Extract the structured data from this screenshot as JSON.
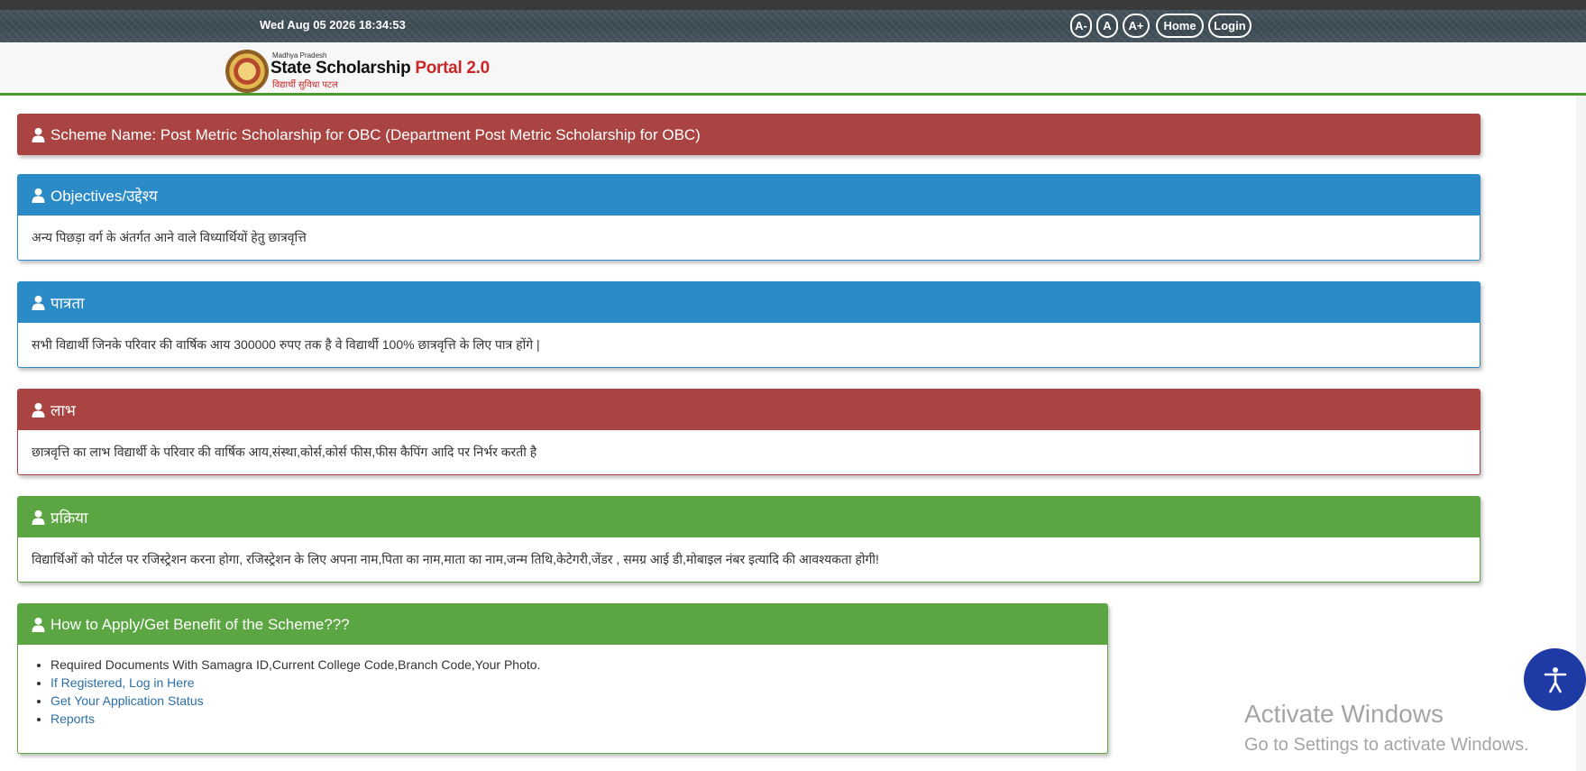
{
  "topbar": {
    "datetime": "Wed Aug 05 2026 18:34:53",
    "font_decrease": "A-",
    "font_normal": "A",
    "font_increase": "A+",
    "home": "Home",
    "login": "Login"
  },
  "header": {
    "logo_state": "Madhya Pradesh",
    "logo_title": "State Scholarship",
    "logo_title_accent": "Portal 2.0",
    "logo_tagline": "विद्यार्थी सुविधा पटल"
  },
  "scheme": {
    "title": "Scheme Name: Post Metric Scholarship for OBC (Department Post Metric Scholarship for OBC)"
  },
  "sections": [
    {
      "title": "Objectives/उद्देश्य",
      "text": "अन्य पिछड़ा वर्ग के अंतर्गत आने वाले विध्यार्थियों हेतु छात्रवृत्ति"
    },
    {
      "title": "पात्रता",
      "text": "सभी विद्यार्थी जिनके परिवार की वार्षिक आय 300000 रुपए तक है वे विद्यार्थी 100% छात्रवृत्ति के लिए पात्र होंगे |"
    },
    {
      "title": "लाभ",
      "text": "छात्रवृत्ति का लाभ विद्यार्थी के परिवार की वार्षिक आय,संस्था,कोर्स,कोर्स फीस,फीस कैपिंग आदि पर निर्भर करती है"
    },
    {
      "title": "प्रक्रिया",
      "text": "विद्यार्थिओं को पोर्टल पर रजिस्ट्रेशन करना होगा, रजिस्ट्रेशन के लिए अपना नाम,पिता का नाम,माता का नाम,जन्म तिथि,केटेगरी,जेंडर , समग्र आई डी,मोबाइल नंबर इत्यादि की आवश्यकता होगी!"
    }
  ],
  "apply": {
    "title": "How to Apply/Get Benefit of the Scheme???",
    "documents": "Required Documents With Samagra ID,Current College Code,Branch Code,Your Photo.",
    "link_login": "If Registered, Log in Here",
    "link_status": "Get Your Application Status",
    "link_reports": "Reports"
  },
  "watermark": {
    "line1": "Activate Windows",
    "line2": "Go to Settings to activate Windows."
  },
  "colors": {
    "red": "#a94442",
    "blue": "#2a8bc6",
    "green": "#5ba542",
    "accessibility": "#1d3aa5"
  },
  "icons": {
    "panel": "user-icon",
    "accessibility": "accessibility-icon"
  }
}
